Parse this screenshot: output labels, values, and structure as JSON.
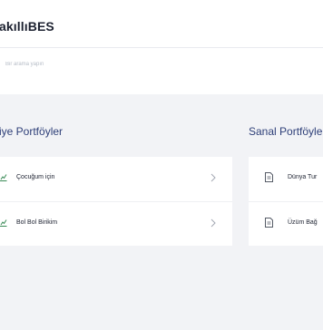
{
  "app": {
    "logo": "akıllıBES"
  },
  "search": {
    "placeholder": "Bir arama yapın"
  },
  "sections": {
    "real": {
      "title": "iye Portföyler",
      "items": [
        {
          "label": "Çocuğum için",
          "icon": "chart-growth-icon"
        },
        {
          "label": "Bol Bol Birikim",
          "icon": "chart-growth-icon"
        }
      ]
    },
    "virtual": {
      "title": "Sanal Portföyle",
      "items": [
        {
          "label": "Dünya Tur",
          "icon": "document-icon"
        },
        {
          "label": "Üzüm Bağ",
          "icon": "document-icon"
        }
      ]
    }
  },
  "colors": {
    "accent": "#2e3f78",
    "icon_green": "#3a8b57",
    "background": "#f2f3f6"
  }
}
